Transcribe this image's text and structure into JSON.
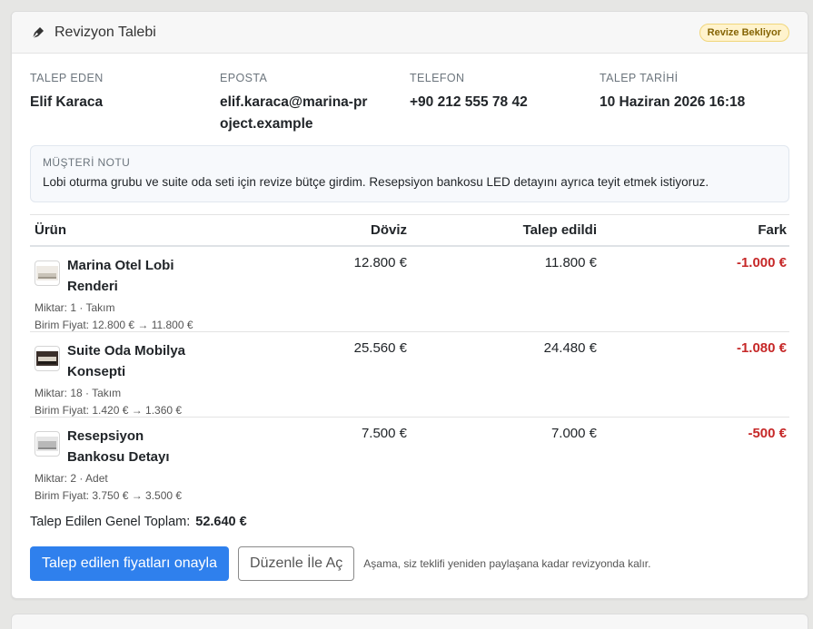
{
  "header": {
    "title": "Revizyon Talebi",
    "badge": "Revize Bekliyor"
  },
  "info": [
    {
      "label": "TALEP EDEN",
      "value": "Elif Karaca"
    },
    {
      "label": "EPOSTA",
      "value": "elif.karaca@marina-project.example"
    },
    {
      "label": "TELEFON",
      "value": "+90 212 555 78 42"
    },
    {
      "label": "TALEP TARİHİ",
      "value": "10 Haziran 2026 16:18"
    }
  ],
  "note": {
    "label": "MÜŞTERİ NOTU",
    "text": "Lobi oturma grubu ve suite oda seti için revize bütçe girdim. Resepsiyon bankosu LED detayını ayrıca teyit etmek istiyoruz."
  },
  "table": {
    "headers": {
      "urun": "Ürün",
      "doviz": "Döviz",
      "talep": "Talep edildi",
      "fark": "Fark"
    },
    "rows": [
      {
        "name": "Marina Otel Lobi Renderi",
        "qty": "Miktar: 1 · Takım",
        "unit": "Birim Fiyat: 12.800 € → 11.800 €",
        "doviz": "12.800 €",
        "talep": "11.800 €",
        "fark": "-1.000 €",
        "thumb": "lobby-thumbnail-icon"
      },
      {
        "name": "Suite Oda Mobilya Konsepti",
        "qty": "Miktar: 18 · Takım",
        "unit": "Birim Fiyat: 1.420 € → 1.360 €",
        "doviz": "25.560 €",
        "talep": "24.480 €",
        "fark": "-1.080 €",
        "thumb": "suite-thumbnail-icon"
      },
      {
        "name": "Resepsiyon Bankosu Detayı",
        "qty": "Miktar: 2 · Adet",
        "unit": "Birim Fiyat: 3.750 € → 3.500 €",
        "doviz": "7.500 €",
        "talep": "7.000 €",
        "fark": "-500 €",
        "thumb": "reception-thumbnail-icon"
      }
    ]
  },
  "total": {
    "label": "Talep Edilen Genel Toplam:",
    "value": "52.640 €"
  },
  "actions": {
    "approve_label": "Talep edilen fiyatları onayla",
    "edit_label": "Düzenle İle Aç",
    "hint": "Aşama, siz teklifi yeniden paylaşana kadar revizyonda kalır."
  },
  "colors": {
    "accent": "#2f80ed",
    "negative": "#c62828",
    "badge_bg": "#fff3cd"
  }
}
